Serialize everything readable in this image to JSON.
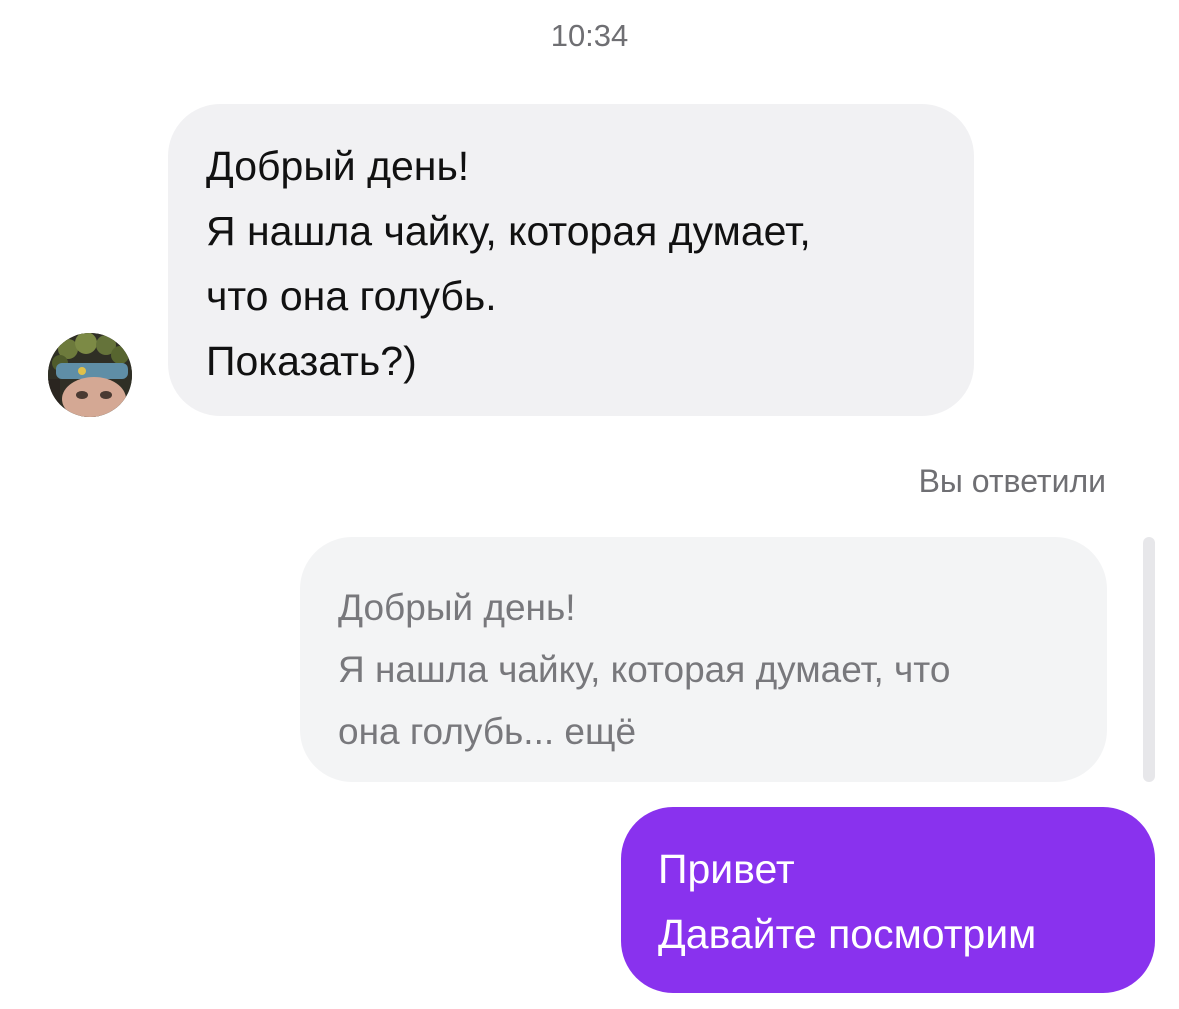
{
  "timestamp": "10:34",
  "incoming_message": {
    "lines": [
      "Добрый день!",
      "Я нашла чайку, которая думает,",
      "что она голубь.",
      "Показать?)"
    ]
  },
  "reply_label": "Вы ответили",
  "quoted_message": {
    "line1": "Добрый день!",
    "line2": "Я нашла чайку, которая думает, что",
    "line3": "она голубь...",
    "more": "ещё"
  },
  "outgoing_message": {
    "lines": [
      "Привет",
      "Давайте посмотрим"
    ]
  },
  "colors": {
    "incoming_bubble": "#f1f1f3",
    "quoted_bubble": "#f3f4f5",
    "outgoing_bubble": "#8932ee",
    "meta_text": "#6f6f73"
  },
  "icons": {
    "avatar": "avatar-photo"
  }
}
